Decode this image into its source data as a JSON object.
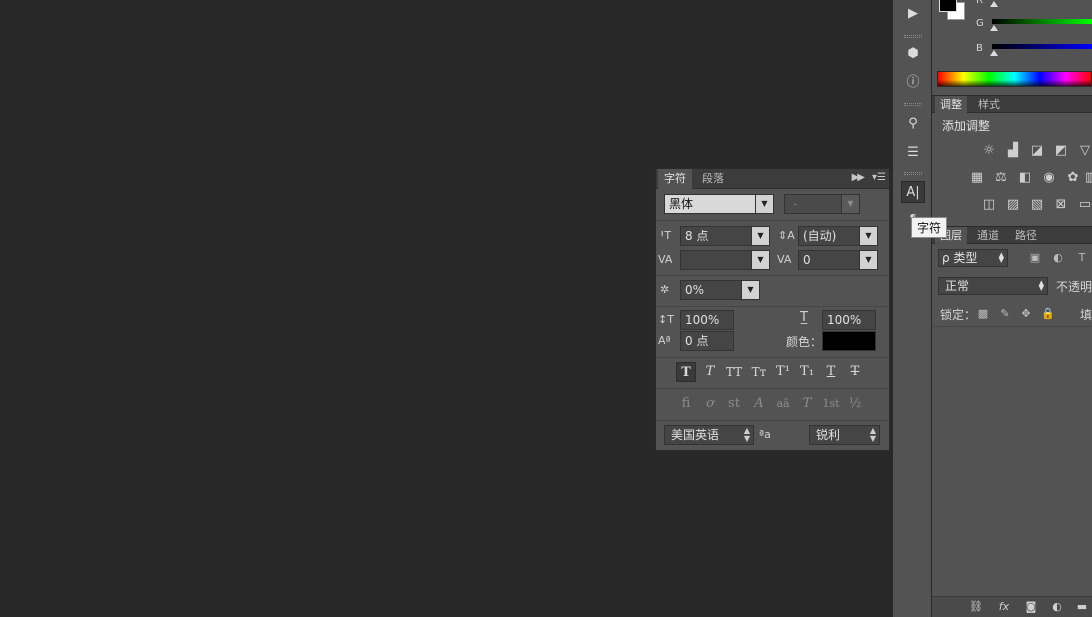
{
  "character_panel": {
    "tabs": [
      "字符",
      "段落"
    ],
    "font_family": "黑体",
    "font_style": "-",
    "font_size": "8 点",
    "leading": "(自动)",
    "kerning": "",
    "tracking": "0",
    "tsume": "0%",
    "vertical_scale": "100%",
    "horizontal_scale": "100%",
    "baseline_shift": "0 点",
    "color_label": "颜色：",
    "color_value": "#000000",
    "language": "美国英语",
    "antialias_glyph": "ªa",
    "antialias": "锐利",
    "type_buttons": [
      "T",
      "T",
      "TT",
      "Tт",
      "T¹",
      "T₁",
      "T",
      "T"
    ],
    "opentype_buttons": [
      "fi",
      "ơ",
      "st",
      "A",
      "aā",
      "T",
      "1st",
      "½"
    ]
  },
  "tooltip": "字符",
  "color_panel": {
    "slider_labels": [
      "R",
      "G",
      "B"
    ]
  },
  "adjustments_panel": {
    "tabs": [
      "调整",
      "样式"
    ],
    "title": "添加调整"
  },
  "layers_panel": {
    "tabs": [
      "图层",
      "通道",
      "路径"
    ],
    "filter_label": "ρ 类型",
    "blend_mode": "正常",
    "opacity_label": "不透明",
    "lock_label": "锁定：",
    "fill_label": "填"
  }
}
